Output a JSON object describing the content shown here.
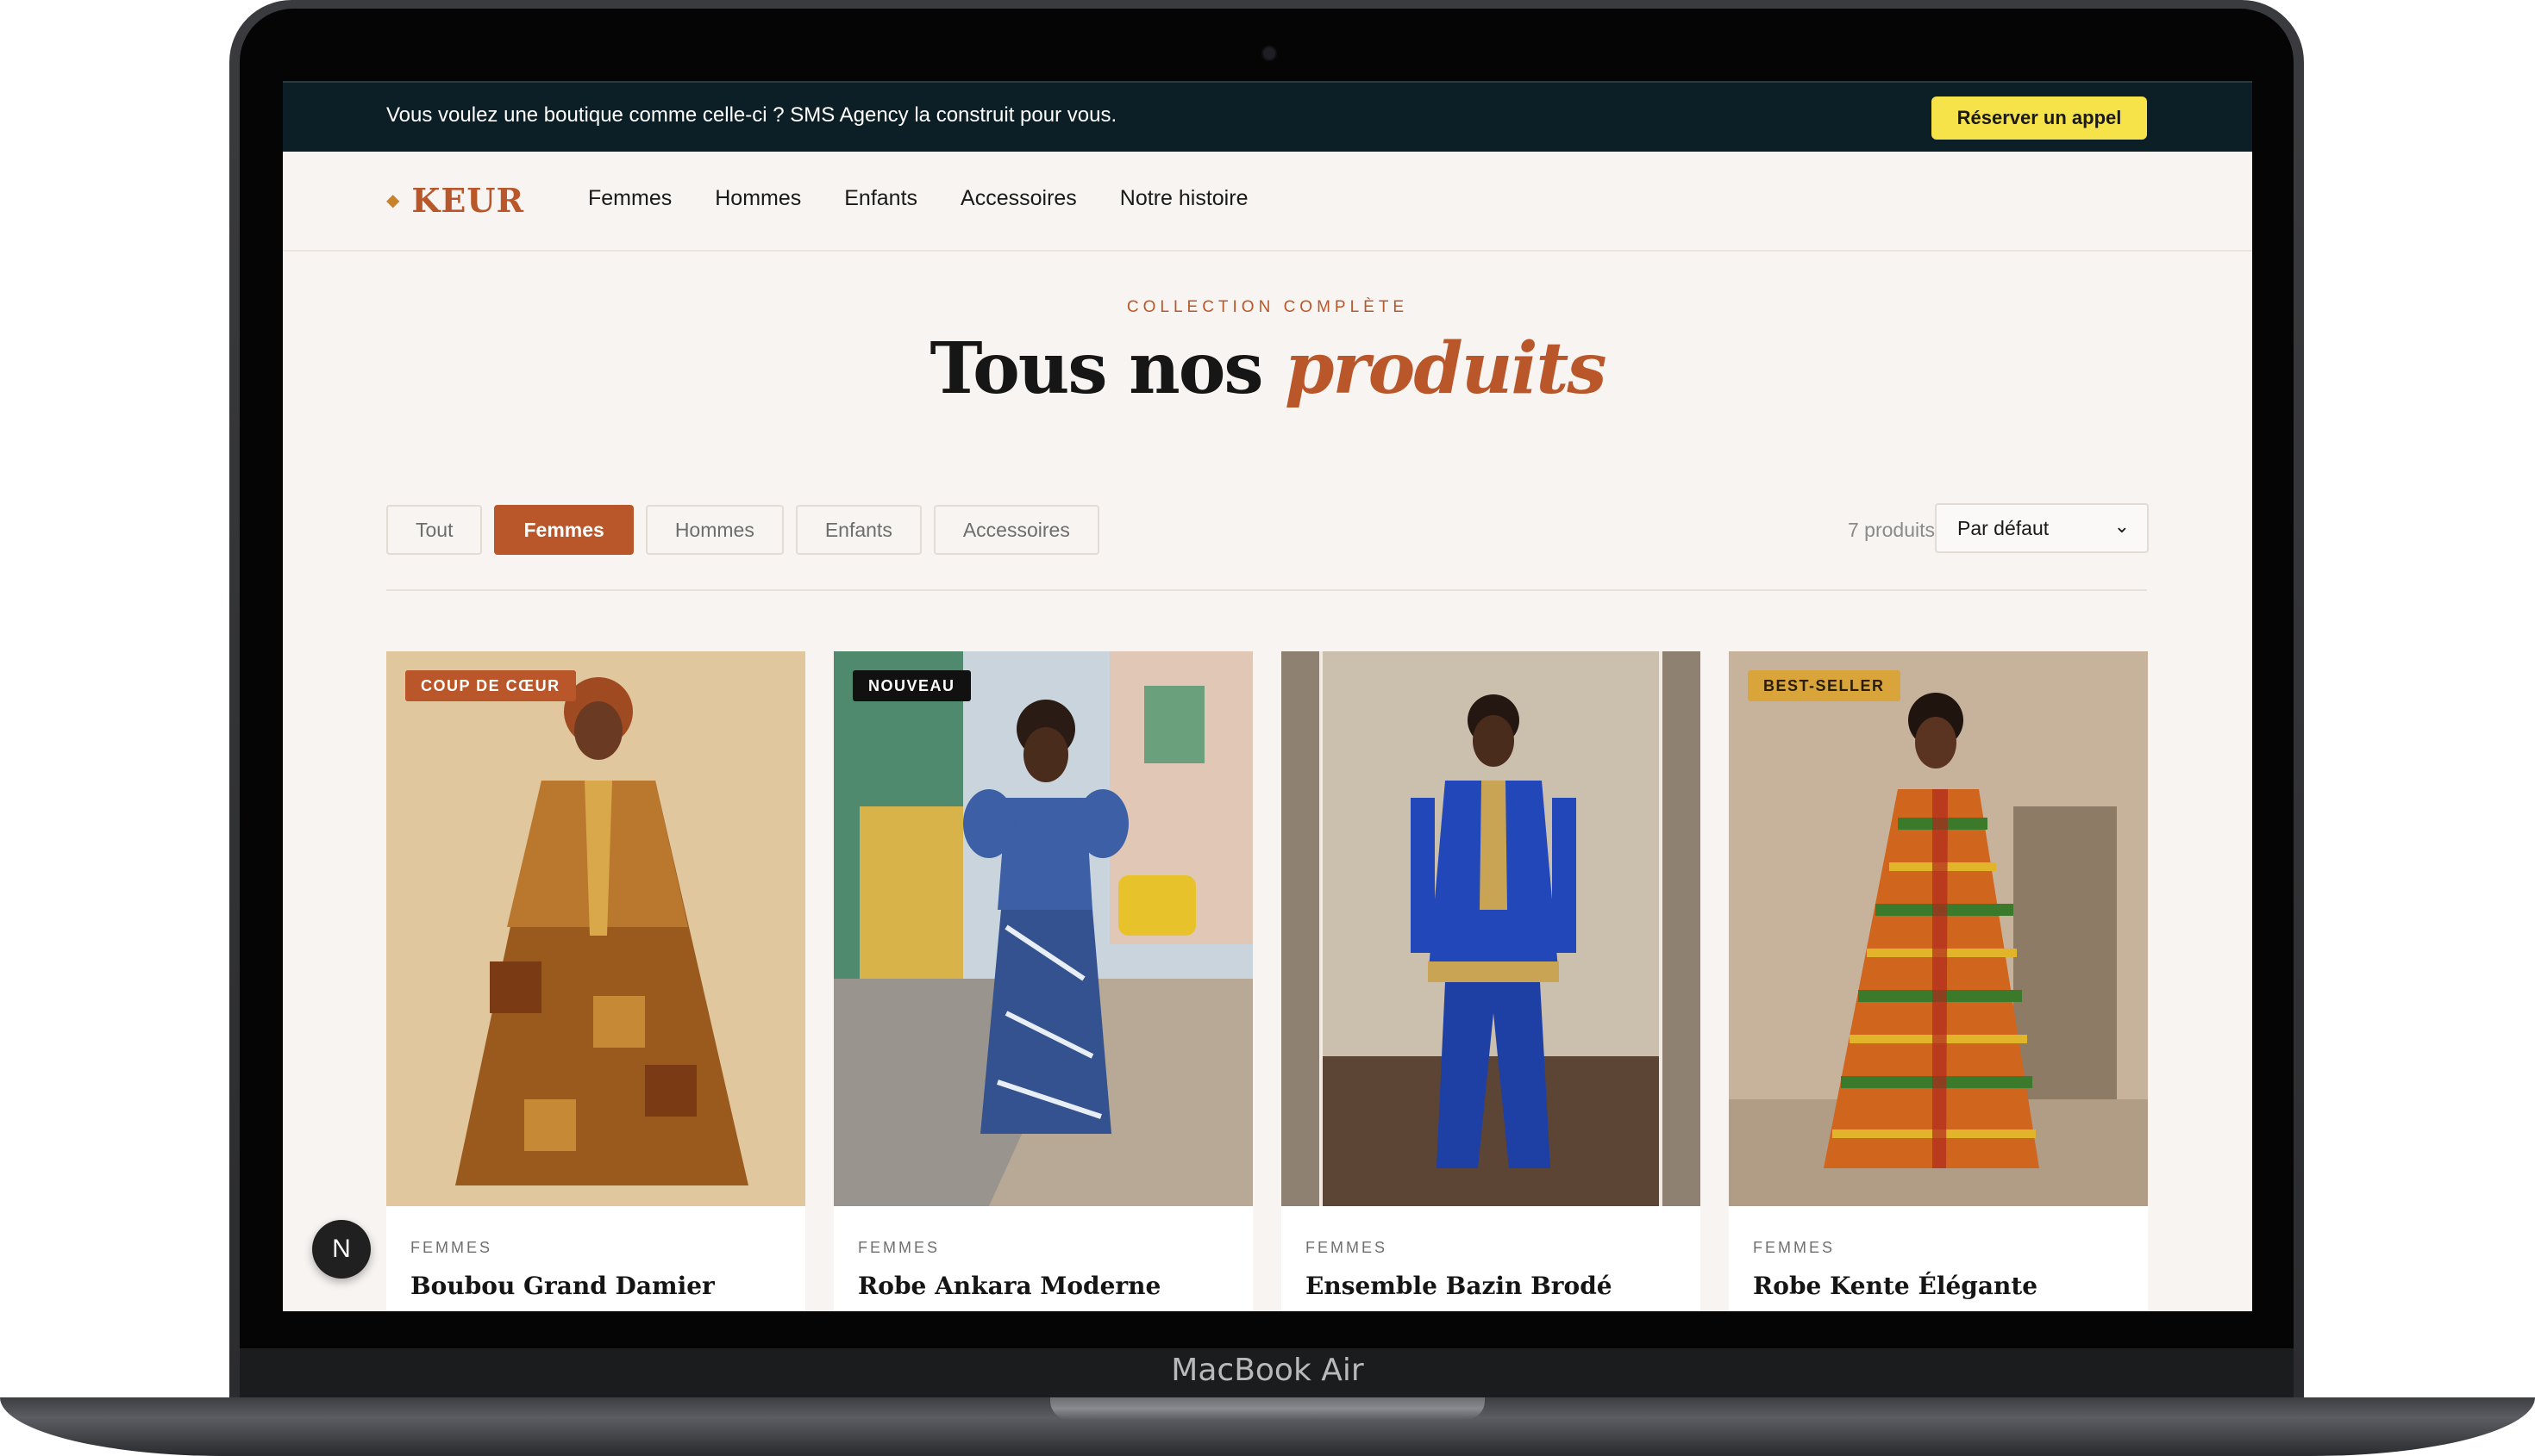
{
  "device": {
    "model_label": "MacBook Air"
  },
  "promo": {
    "text": "Vous voulez une boutique comme celle-ci ?  SMS Agency la construit pour vous.",
    "cta": "Réserver un appel"
  },
  "header": {
    "logo": "KEUR",
    "logo_icon": "diamond-icon",
    "nav": [
      "Femmes",
      "Hommes",
      "Enfants",
      "Accessoires",
      "Notre histoire"
    ]
  },
  "hero": {
    "kicker": "COLLECTION COMPLÈTE",
    "title_plain": "Tous nos",
    "title_accent": "produits"
  },
  "filters": {
    "chips": [
      "Tout",
      "Femmes",
      "Hommes",
      "Enfants",
      "Accessoires"
    ],
    "active": "Femmes",
    "count": "7 produits",
    "sort": "Par défaut"
  },
  "products": [
    {
      "badge": "COUP DE CŒUR",
      "badge_bg": "#b9572b",
      "badge_fg": "#ffffff",
      "category": "FEMMES",
      "name": "Boubou Grand Damier"
    },
    {
      "badge": "NOUVEAU",
      "badge_bg": "#111111",
      "badge_fg": "#ffffff",
      "category": "FEMMES",
      "name": "Robe Ankara Moderne"
    },
    {
      "badge": "",
      "badge_bg": "",
      "badge_fg": "",
      "category": "FEMMES",
      "name": "Ensemble Bazin Brodé"
    },
    {
      "badge": "BEST-SELLER",
      "badge_bg": "#d9a53a",
      "badge_fg": "#2a1d06",
      "category": "FEMMES",
      "name": "Robe Kente Élégante"
    }
  ],
  "fab": {
    "label": "N"
  },
  "colors": {
    "accent": "#b9572b",
    "promo_bg": "#0c1f26",
    "cta_bg": "#f6e34a",
    "page_bg": "#f7f4f1"
  }
}
